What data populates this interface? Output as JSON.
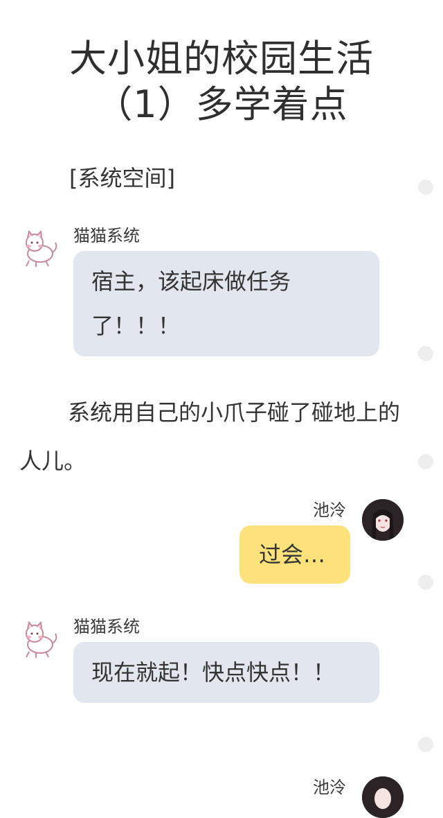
{
  "article": {
    "title_line1": "大小姐的校园生活",
    "title_line2": "（1）多学着点",
    "section_label": "[系统空间]",
    "narration": "系统用自己的小爪子碰了碰地上的人儿。"
  },
  "messages": [
    {
      "sender": "猫猫系统",
      "text": "宿主，该起床做任务了！！！",
      "side": "left",
      "bubble_color": "#e1e6ef"
    },
    {
      "sender": "池泠",
      "text": "过会…",
      "side": "right",
      "bubble_color": "#fde27c"
    },
    {
      "sender": "猫猫系统",
      "text": "现在就起！快点快点！！",
      "side": "left",
      "bubble_color": "#e1e6ef"
    },
    {
      "sender": "池泠",
      "text": "",
      "side": "right"
    }
  ],
  "icons": {
    "cat_avatar": "cat-avatar-icon",
    "girl_avatar": "girl-avatar-icon",
    "side_dot": "dot-icon"
  }
}
